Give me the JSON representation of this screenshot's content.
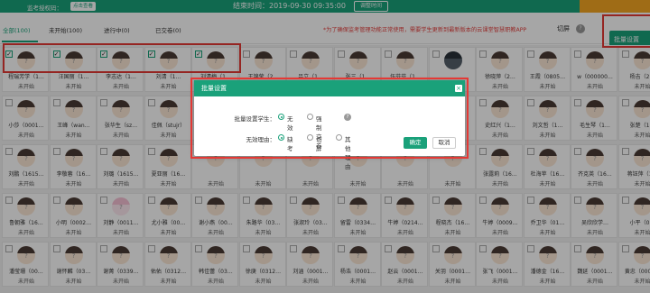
{
  "topbar": {
    "code_label": "监考授权码：",
    "view_btn": "点击查看",
    "end_time": "结束时间：2019-09-30 09:35:00",
    "adjust_btn": "调整时间"
  },
  "tabs": [
    {
      "label": "全部(100)"
    },
    {
      "label": "未开始(100)"
    },
    {
      "label": "进行中(0)"
    },
    {
      "label": "已交卷(0)"
    }
  ],
  "notice": "*为了确保监考管理功能正常使用，需要学生更新到最新版本的云课堂智慧职教APP",
  "switch_screen_label": "切屏",
  "help_mark": "?",
  "batch_btn": "批量设置",
  "students": [
    [
      "程瑞芳学（1…",
      "汪国丽（1…",
      "李志达（1…",
      "刘清（1…",
      "刘清梅（1…",
      "王锦莹（2…",
      "吕立（1…",
      "张三（1…",
      "伍芬芬（1…",
      "",
      "徐晓萍（2…",
      "王霞（0805…",
      "w（000000…",
      "杨吉（2…"
    ],
    [
      "小莎（0001…",
      "王峰（wan…",
      "张华生（sz…",
      "佳佩（stujr）",
      "",
      "",
      "",
      "",
      "",
      "",
      "史红兴（1…",
      "刘文哲（1…",
      "毛生琴（1…",
      "张楚（1…"
    ],
    [
      "刘鹏（1615…",
      "李敬蓉（16…",
      "刘璐（1615…",
      "夏亚丽（16…",
      "",
      "",
      "",
      "",
      "",
      "",
      "张露莉（16…",
      "杜海苹（16…",
      "齐克英（16…",
      "蒋钰萍（1…"
    ],
    [
      "鲁朝雅（16…",
      "小明（0002…",
      "刘静（0011…",
      "尤小雅（00…",
      "谢小燕（00…",
      "朱路华（03…",
      "张淑玲（03…",
      "留雷（0334…",
      "牛婷（0214…",
      "程晓杰（16…",
      "牛婷（0009…",
      "乔卫华（01…",
      "吴欣欣学…",
      "小平（0…"
    ],
    [
      "潘莹珊（00…",
      "谢怀麟（03…",
      "谢菁（0339…",
      "佑佑（0312…",
      "韩佳蕾（03…",
      "徐庚（0312…",
      "刘涵（0001…",
      "杨浩（0001…",
      "赵云（0001…",
      "关羽（0001…",
      "张飞（0001…",
      "潘德金（16…",
      "魏延（0001…",
      "黄忠（0001…"
    ]
  ],
  "status_not_started": "未开始",
  "checked_count": 5,
  "dialog": {
    "title": "批量设置",
    "close": "×",
    "row1_label": "批量设置学生：",
    "row1_opt1": "无效",
    "row1_opt2": "强制交卷",
    "row1_help": "?",
    "row2_label": "无效理由：",
    "row2_opt1": "缺考",
    "row2_opt2": "切屏",
    "row2_opt3": "其他理由",
    "ok": "确定",
    "cancel": "取消"
  },
  "colors": {
    "primary": "#1aa17a",
    "warning": "#f5a623",
    "danger": "#e53935"
  }
}
